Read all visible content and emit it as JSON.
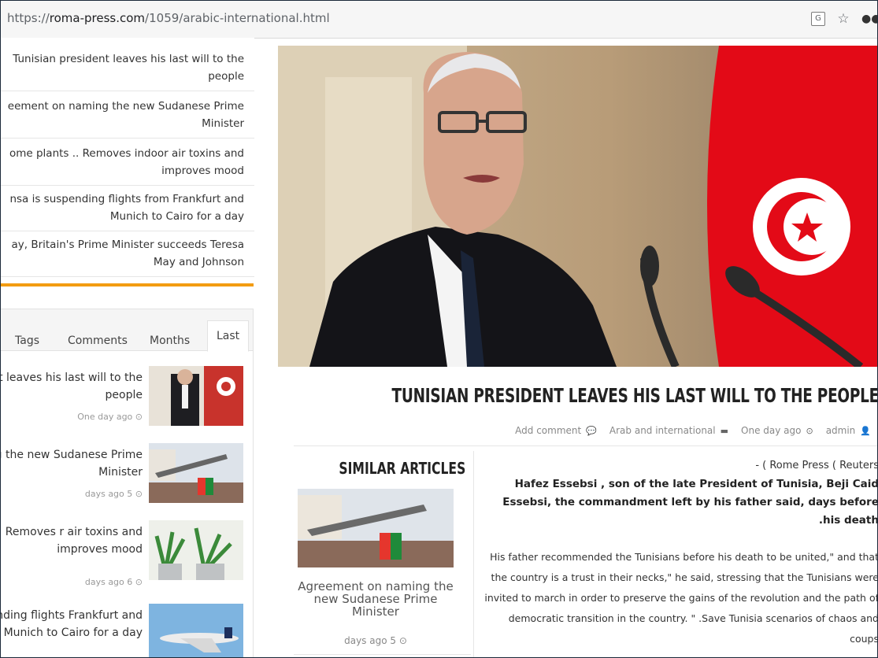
{
  "browser": {
    "url_prefix": "https://",
    "url_host": "roma-press.com",
    "url_path": "/1059/arabic-international.html"
  },
  "sidebar": {
    "latest_news": [
      {
        "title": "Tunisian president leaves his last will to the people"
      },
      {
        "title": "eement on naming the new Sudanese Prime Minister"
      },
      {
        "title": "ome plants .. Removes indoor air toxins and improves mood"
      },
      {
        "title": "nsa is suspending flights from Frankfurt and Munich to Cairo for a day"
      },
      {
        "title": "ay, Britain's Prime Minister succeeds Teresa May and Johnson"
      }
    ],
    "tabs": [
      {
        "label": "Tags"
      },
      {
        "label": "Comments"
      },
      {
        "label": "Months"
      },
      {
        "label": "Last"
      }
    ],
    "posts": [
      {
        "title": "sian president leaves his last will to the people",
        "time": "One day ago"
      },
      {
        "title": "ment on naming the new Sudanese Prime Minister",
        "time": "days ago 5"
      },
      {
        "title": "Home plants .. Removes r air toxins and improves mood",
        "time": "days ago 6"
      },
      {
        "title": "nsa is suspending flights Frankfurt and Munich to Cairo for a day",
        "time": ""
      }
    ]
  },
  "article": {
    "headline": "TUNISIAN PRESIDENT LEAVES HIS LAST WILL TO THE PEOPLE",
    "meta": {
      "comments": "Add comment",
      "category": "Arab and international",
      "time": "One day ago",
      "author": "admin"
    },
    "source": "- ( Rome Press ( Reuters",
    "lead": "Hafez Essebsi , son of the late President of Tunisia, Beji Caid Essebsi, the commandment left by his father said, days before .his death",
    "body": "His father recommended the Tunisians before his death to be united,\" and that the country is a trust in their necks,\" he said, stressing that the Tunisians were invited to march in order to preserve the gains of the revolution and the path of democratic transition in the country. \" .Save Tunisia scenarios of chaos and coups"
  },
  "similar": {
    "title": "SIMILAR ARTICLES",
    "item_title": "Agreement on naming the new Sudanese Prime Minister",
    "item_time": "days ago 5"
  },
  "colors": {
    "accent": "#f39c12",
    "flag_red": "#e30a17"
  }
}
